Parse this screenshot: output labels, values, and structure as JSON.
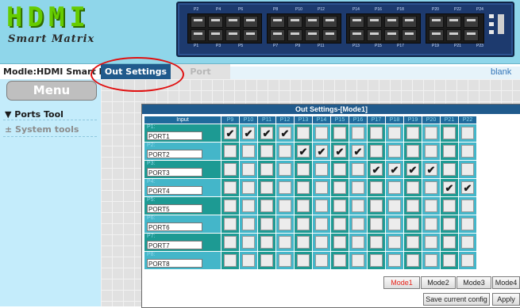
{
  "header": {
    "logo_title": "HDMI",
    "logo_subtitle": "Smart Matrix",
    "device_ports_top": [
      "P2",
      "P4",
      "P6",
      "P8",
      "P10",
      "P12",
      "P14",
      "P16",
      "P18",
      "P20",
      "P22",
      "P24"
    ],
    "device_ports_bottom": [
      "P1",
      "P3",
      "P5",
      "P7",
      "P9",
      "P11",
      "P13",
      "P15",
      "P17",
      "P19",
      "P21",
      "P23"
    ]
  },
  "nav": {
    "model_label": "Modle:HDMI Smart Matrix",
    "tabs": [
      {
        "label": "Out Settings",
        "active": true
      },
      {
        "label": "Port Setting",
        "active": false
      }
    ],
    "blank_tab": "blank"
  },
  "sidebar": {
    "menu_title": "Menu",
    "items": [
      {
        "label": "▼ Ports Tool",
        "icon": "triangle-down-icon"
      },
      {
        "label": "± System tools",
        "icon": "plus-minus-icon"
      }
    ]
  },
  "panel": {
    "title": "Out Settings-[Mode1]",
    "input_header": "Input",
    "output_headers": [
      "P9",
      "P10",
      "P11",
      "P12",
      "P13",
      "P14",
      "P15",
      "P16",
      "P17",
      "P18",
      "P19",
      "P20",
      "P21",
      "P22"
    ],
    "rows": [
      {
        "port": "P1:",
        "name": "PORT1",
        "checked": [
          true,
          true,
          true,
          true,
          false,
          false,
          false,
          false,
          false,
          false,
          false,
          false,
          false,
          false
        ]
      },
      {
        "port": "P2:",
        "name": "PORT2",
        "checked": [
          false,
          false,
          false,
          false,
          true,
          true,
          true,
          true,
          false,
          false,
          false,
          false,
          false,
          false
        ]
      },
      {
        "port": "P3:",
        "name": "PORT3",
        "checked": [
          false,
          false,
          false,
          false,
          false,
          false,
          false,
          false,
          true,
          true,
          true,
          true,
          false,
          false
        ]
      },
      {
        "port": "P4:",
        "name": "PORT4",
        "checked": [
          false,
          false,
          false,
          false,
          false,
          false,
          false,
          false,
          false,
          false,
          false,
          false,
          true,
          true
        ]
      },
      {
        "port": "P5:",
        "name": "PORT5",
        "checked": [
          false,
          false,
          false,
          false,
          false,
          false,
          false,
          false,
          false,
          false,
          false,
          false,
          false,
          false
        ]
      },
      {
        "port": "P6:",
        "name": "PORT6",
        "checked": [
          false,
          false,
          false,
          false,
          false,
          false,
          false,
          false,
          false,
          false,
          false,
          false,
          false,
          false
        ]
      },
      {
        "port": "P7:",
        "name": "PORT7",
        "checked": [
          false,
          false,
          false,
          false,
          false,
          false,
          false,
          false,
          false,
          false,
          false,
          false,
          false,
          false
        ]
      },
      {
        "port": "P8:",
        "name": "PORT8",
        "checked": [
          false,
          false,
          false,
          false,
          false,
          false,
          false,
          false,
          false,
          false,
          false,
          false,
          false,
          false
        ]
      }
    ],
    "mode_buttons": [
      "Mode1",
      "Mode2",
      "Mode3",
      "Mode4"
    ],
    "active_mode": "Mode1",
    "save_button": "Save current config",
    "apply_button": "Apply"
  },
  "colors": {
    "header_bg": "#8fd6ea",
    "logo_green": "#66cc00",
    "device_blue": "#1d3a6e",
    "active_tab": "#205a8c",
    "sidebar_bg": "#c4ecfb",
    "row_teal": "#1d9a93",
    "row_cyan": "#44b6c9",
    "annotation_red": "#e01010",
    "active_mode_text": "#e8241b"
  }
}
